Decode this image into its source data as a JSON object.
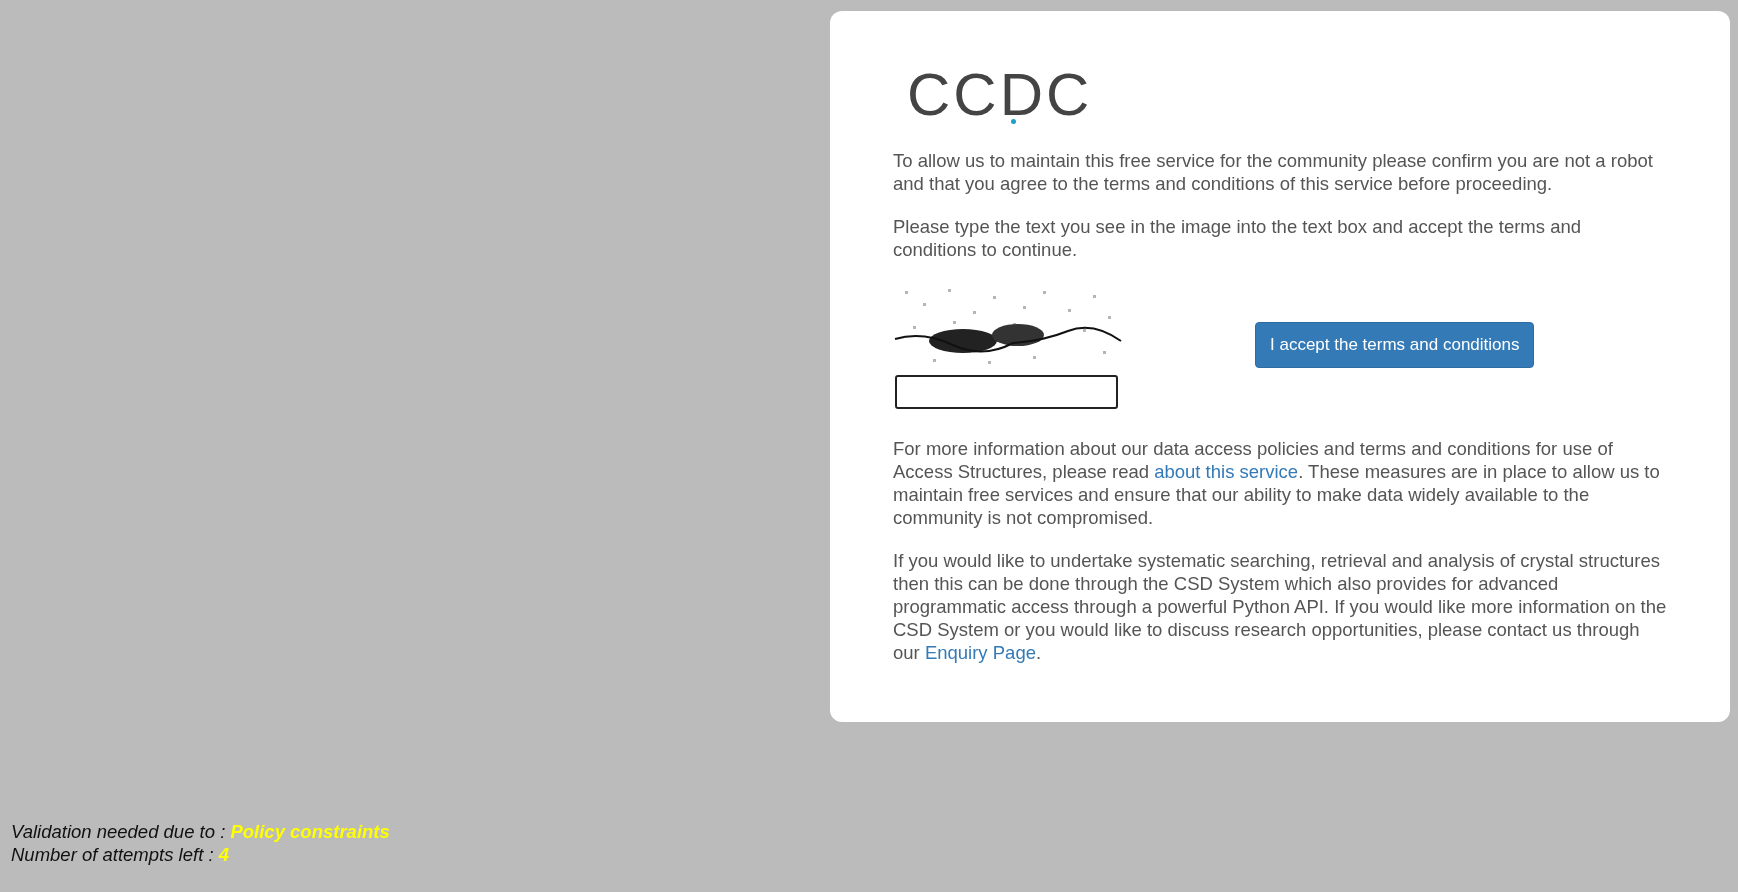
{
  "logo": {
    "text": "CCDC"
  },
  "intro": [
    "To allow us to maintain this free service for the community please confirm you are not a robot and that you agree to the terms and conditions of this service before proceeding.",
    "Please type the text you see in the image into the text box and accept the terms and conditions to continue."
  ],
  "captcha": {
    "kind": "picture"
  },
  "accept_button": "I accept the terms and conditions",
  "info": [
    [
      {
        "kind": "text",
        "text": "For more information about our data access policies and terms and conditions for use of Access Structures, please read "
      },
      {
        "kind": "link",
        "text": "about this service"
      },
      {
        "kind": "text",
        "text": ". These measures are in place to allow us to maintain free services and ensure that our ability to make data widely available to the community is not compromised."
      }
    ],
    [
      {
        "kind": "text",
        "text": "If you would like to undertake systematic searching, retrieval and analysis of crystal structures then this can be done through the CSD System which also provides for advanced programmatic access through a powerful Python API. If you would like more information on the CSD System or you would like to discuss research opportunities, please contact us through our "
      },
      {
        "kind": "link",
        "text": "Enquiry Page"
      },
      {
        "kind": "text",
        "text": "."
      }
    ]
  ],
  "status": [
    {
      "label": "Validation needed due to :",
      "value": "Policy constraints"
    },
    {
      "label": "Number of attempts left :",
      "value": "4"
    }
  ]
}
